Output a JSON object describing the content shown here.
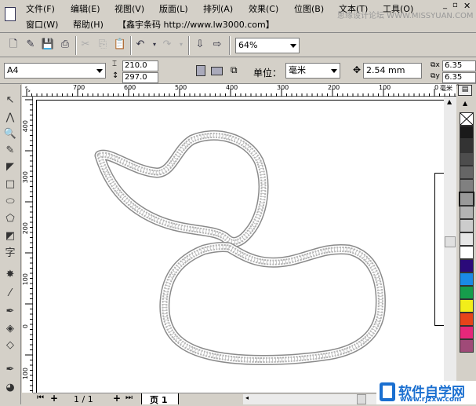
{
  "menu": {
    "row1": [
      "文件(F)",
      "编辑(E)",
      "视图(V)",
      "版面(L)",
      "排列(A)",
      "效果(C)",
      "位图(B)",
      "文本(T)",
      "工具(O)"
    ],
    "row2": [
      "窗口(W)",
      "帮助(H)",
      "【鑫宇条码 http://www.lw3000.com】"
    ]
  },
  "watermark_top": "思缘设计论坛 WWW.MISSYUAN.COM",
  "toolbar": {
    "zoom": "64%"
  },
  "property_bar": {
    "page_size": "A4",
    "width": "210.0 mm",
    "height": "297.0 mm",
    "unit_label": "单位：",
    "unit": "毫米",
    "nudge": "2.54 mm",
    "dup_x": "6.35 mm",
    "dup_y": "6.35 mm",
    "x_label": "x",
    "y_label": "y"
  },
  "ruler": {
    "top": [
      "700",
      "600",
      "500",
      "400",
      "300",
      "200",
      "100",
      "0"
    ],
    "unit": "毫米",
    "left": [
      "400",
      "300",
      "200",
      "100",
      "0",
      "100"
    ]
  },
  "page_nav": {
    "count": "1 / 1",
    "tab": "页 1"
  },
  "palette": [
    "#1a1a1a",
    "#333333",
    "#4d4d4d",
    "#666666",
    "#808080",
    "#999999",
    "#b3b3b3",
    "#cccccc",
    "#e6e6e6",
    "#ffffff",
    "#2b0a7a",
    "#1a8ae6",
    "#169c4c",
    "#f2ee1a",
    "#e6441a",
    "#e6277a",
    "#a04a78"
  ],
  "watermark_bottom": {
    "brand": "软件自学网",
    "url": "www.rjzxw.com"
  }
}
